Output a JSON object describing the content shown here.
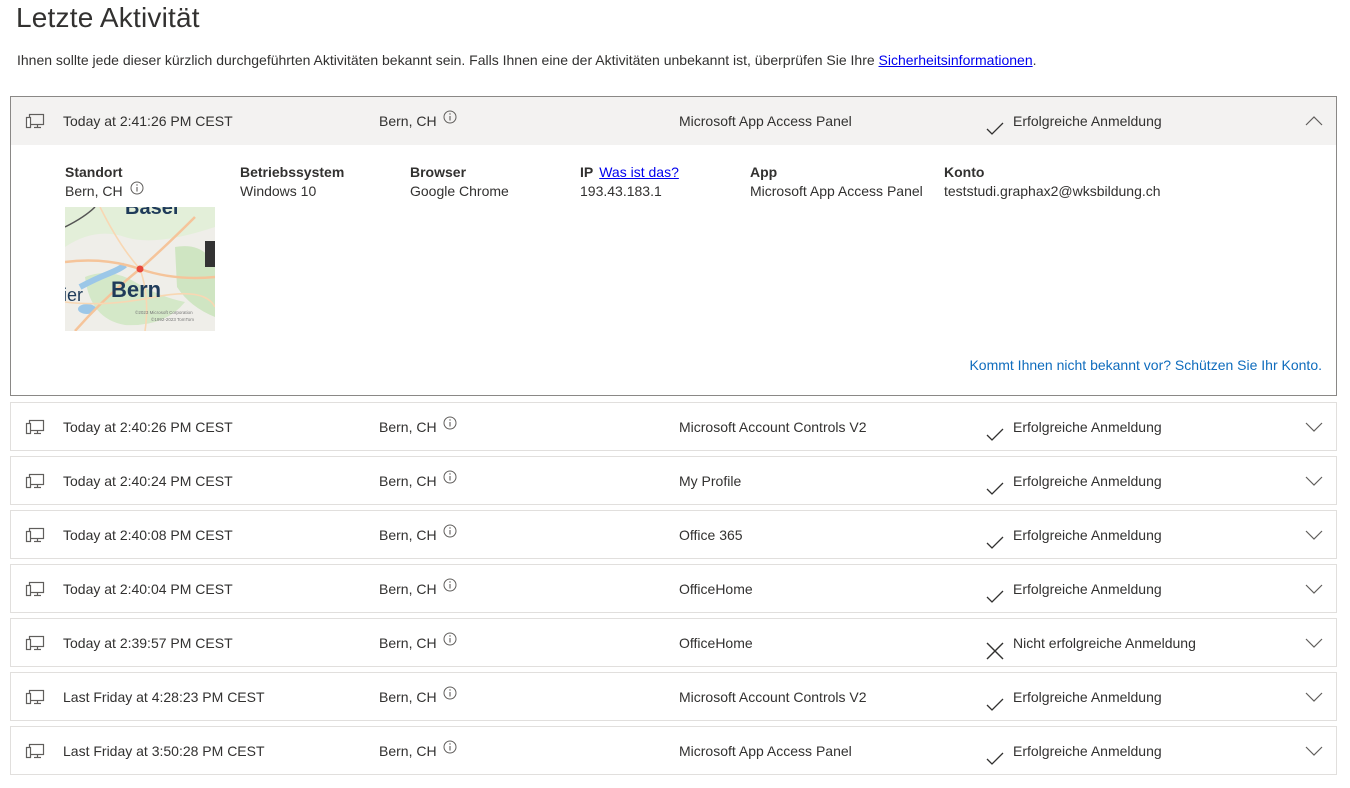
{
  "page": {
    "title": "Letzte Aktivität",
    "intro_text": "Ihnen sollte jede dieser kürzlich durchgeführten Aktivitäten bekannt sein. Falls Ihnen eine der Aktivitäten unbekannt ist, überprüfen Sie Ihre ",
    "intro_link": "Sicherheitsinformationen",
    "intro_end": "."
  },
  "expanded": {
    "time": "Today at 2:41:26 PM CEST",
    "location": "Bern, CH",
    "app": "Microsoft App Access Panel",
    "status": "Erfolgreiche Anmeldung",
    "details": {
      "standort_label": "Standort",
      "standort_value": "Bern, CH",
      "os_label": "Betriebssystem",
      "os_value": "Windows 10",
      "browser_label": "Browser",
      "browser_value": "Google Chrome",
      "ip_label": "IP",
      "ip_help_link": "Was ist das?",
      "ip_value": "193.43.183.1",
      "app_label": "App",
      "app_value": "Microsoft App Access Panel",
      "konto_label": "Konto",
      "konto_value": "teststudi.graphax2@wksbildung.ch",
      "map_city": "Bern",
      "map_city_partial_left": "lier",
      "map_city_partial_top": "Basel",
      "map_copyright_1": "©2023 Microsoft Corporation",
      "map_copyright_2": "©1992-2023 TomTom",
      "protect_link": "Kommt Ihnen nicht bekannt vor? Schützen Sie Ihr Konto."
    }
  },
  "activities": [
    {
      "time": "Today at 2:40:26 PM CEST",
      "location": "Bern, CH",
      "app": "Microsoft Account Controls V2",
      "status": "Erfolgreiche Anmeldung",
      "success": true
    },
    {
      "time": "Today at 2:40:24 PM CEST",
      "location": "Bern, CH",
      "app": "My Profile",
      "status": "Erfolgreiche Anmeldung",
      "success": true
    },
    {
      "time": "Today at 2:40:08 PM CEST",
      "location": "Bern, CH",
      "app": "Office 365",
      "status": "Erfolgreiche Anmeldung",
      "success": true
    },
    {
      "time": "Today at 2:40:04 PM CEST",
      "location": "Bern, CH",
      "app": "OfficeHome",
      "status": "Erfolgreiche Anmeldung",
      "success": true
    },
    {
      "time": "Today at 2:39:57 PM CEST",
      "location": "Bern, CH",
      "app": "OfficeHome",
      "status": "Nicht erfolgreiche Anmeldung",
      "success": false
    },
    {
      "time": "Last Friday at 4:28:23 PM CEST",
      "location": "Bern, CH",
      "app": "Microsoft Account Controls V2",
      "status": "Erfolgreiche Anmeldung",
      "success": true
    },
    {
      "time": "Last Friday at 3:50:28 PM CEST",
      "location": "Bern, CH",
      "app": "Microsoft App Access Panel",
      "status": "Erfolgreiche Anmeldung",
      "success": true
    }
  ],
  "colors": {
    "link": "#0000ee",
    "accent_link": "#0f6cbd",
    "expanded_header_bg": "#f3f2f1",
    "border": "#e1dfdd"
  }
}
